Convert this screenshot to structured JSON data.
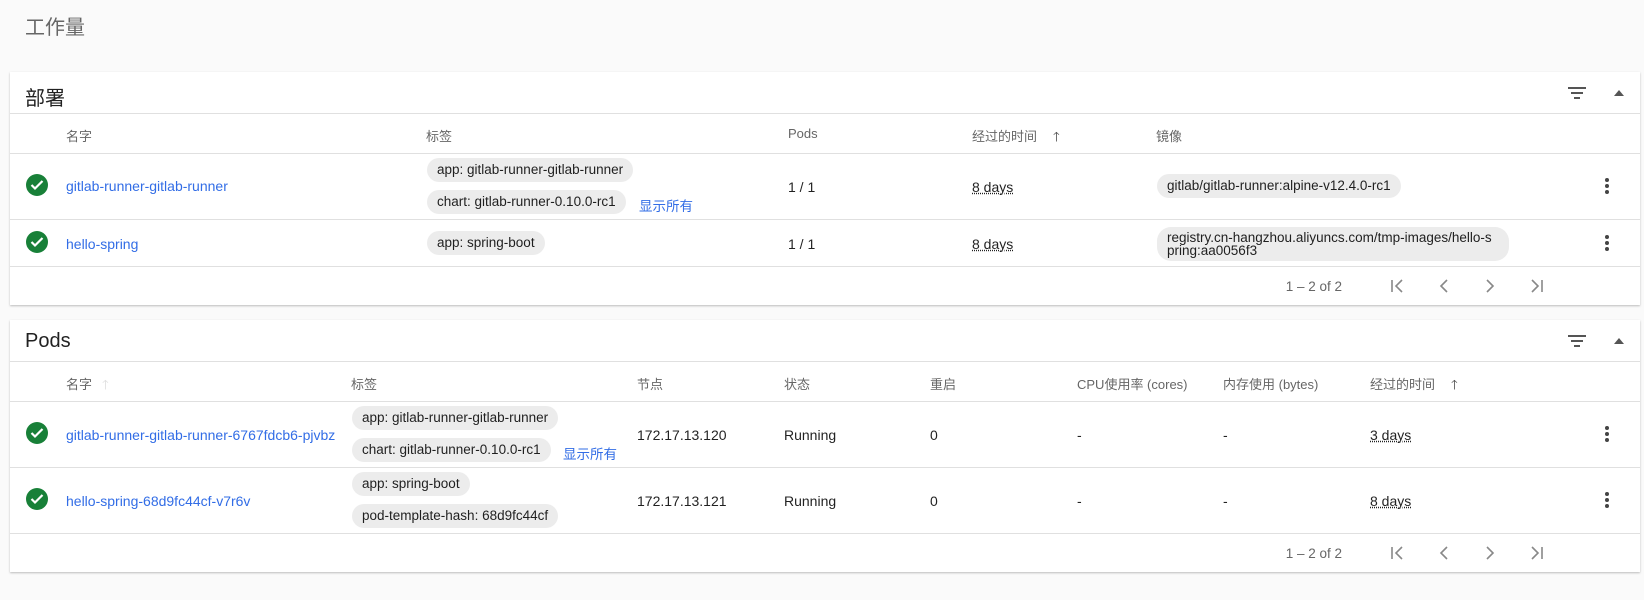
{
  "page_title": "工作量",
  "colors": {
    "accent": "#326de6",
    "success": "#188038"
  },
  "icons": {
    "filter": "filter-icon",
    "collapse": "chevron-up-icon",
    "status": "check-circle-icon",
    "menu": "more-vert-icon"
  },
  "deployments": {
    "title": "部署",
    "columns": {
      "name": "名字",
      "labels": "标签",
      "pods": "Pods",
      "age": "经过的时间",
      "images": "镜像"
    },
    "rows": [
      {
        "name": "gitlab-runner-gitlab-runner",
        "labels": [
          "app: gitlab-runner-gitlab-runner",
          "chart: gitlab-runner-0.10.0-rc1"
        ],
        "show_all": "显示所有",
        "pods": "1 / 1",
        "age": "8 days",
        "image": "gitlab/gitlab-runner:alpine-v12.4.0-rc1"
      },
      {
        "name": "hello-spring",
        "labels": [
          "app: spring-boot"
        ],
        "pods": "1 / 1",
        "age": "8 days",
        "image": "registry.cn-hangzhou.aliyuncs.com/tmp-images/hello-spring:aa0056f3"
      }
    ],
    "pagination": "1 – 2 of 2"
  },
  "pods": {
    "title": "Pods",
    "columns": {
      "name": "名字",
      "labels": "标签",
      "node": "节点",
      "status": "状态",
      "restarts": "重启",
      "cpu": "CPU使用率 (cores)",
      "memory": "内存使用 (bytes)",
      "age": "经过的时间"
    },
    "rows": [
      {
        "name": "gitlab-runner-gitlab-runner-6767fdcb6-pjvbz",
        "labels": [
          "app: gitlab-runner-gitlab-runner",
          "chart: gitlab-runner-0.10.0-rc1"
        ],
        "show_all": "显示所有",
        "node": "172.17.13.120",
        "status": "Running",
        "restarts": "0",
        "cpu": "-",
        "memory": "-",
        "age": "3 days"
      },
      {
        "name": "hello-spring-68d9fc44cf-v7r6v",
        "labels": [
          "app: spring-boot",
          "pod-template-hash: 68d9fc44cf"
        ],
        "node": "172.17.13.121",
        "status": "Running",
        "restarts": "0",
        "cpu": "-",
        "memory": "-",
        "age": "8 days"
      }
    ],
    "pagination": "1 – 2 of 2"
  }
}
